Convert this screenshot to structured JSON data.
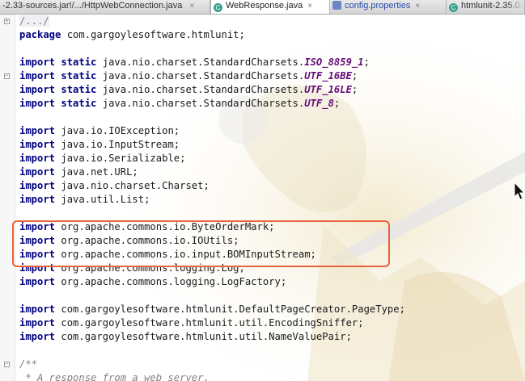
{
  "tabs": [
    {
      "label": "-2.33-sources.jar!/.../HttpWebConnection.java",
      "icon": "java-class-icon",
      "active": false
    },
    {
      "label": "WebResponse.java",
      "icon": "java-class-icon",
      "active": true
    },
    {
      "label": "config.properties",
      "icon": "properties-file-icon",
      "active": false
    },
    {
      "label": "htmlunit-2.35.0-",
      "icon": "java-class-icon",
      "active": false
    }
  ],
  "close_glyph": "×",
  "code": {
    "header_fold": "/.../",
    "package_kw": "package",
    "package_name": " com.gargoylesoftware.htmlunit;",
    "import_kw": "import",
    "static_kw": "static",
    "static_prefix": " java.nio.charset.StandardCharsets.",
    "static_consts": [
      "ISO_8859_1",
      "UTF_16BE",
      "UTF_16LE",
      "UTF_8"
    ],
    "java_imports": [
      " java.io.IOException;",
      " java.io.InputStream;",
      " java.io.Serializable;",
      " java.net.URL;",
      " java.nio.charset.Charset;",
      " java.util.List;"
    ],
    "commons_imports": [
      " org.apache.commons.io.ByteOrderMark;",
      " org.apache.commons.io.IOUtils;",
      " org.apache.commons.io.input.BOMInputStream;",
      " org.apache.commons.logging.Log;",
      " org.apache.commons.logging.LogFactory;"
    ],
    "htmlunit_imports": [
      " com.gargoylesoftware.htmlunit.DefaultPageCreator.PageType;",
      " com.gargoylesoftware.htmlunit.util.EncodingSniffer;",
      " com.gargoylesoftware.htmlunit.util.NameValuePair;"
    ],
    "javadoc_open": "/**",
    "javadoc_line": " * A response from a web server."
  },
  "colors": {
    "keyword": "#000080",
    "constant": "#660e7a",
    "highlight_border": "#e8623c"
  }
}
